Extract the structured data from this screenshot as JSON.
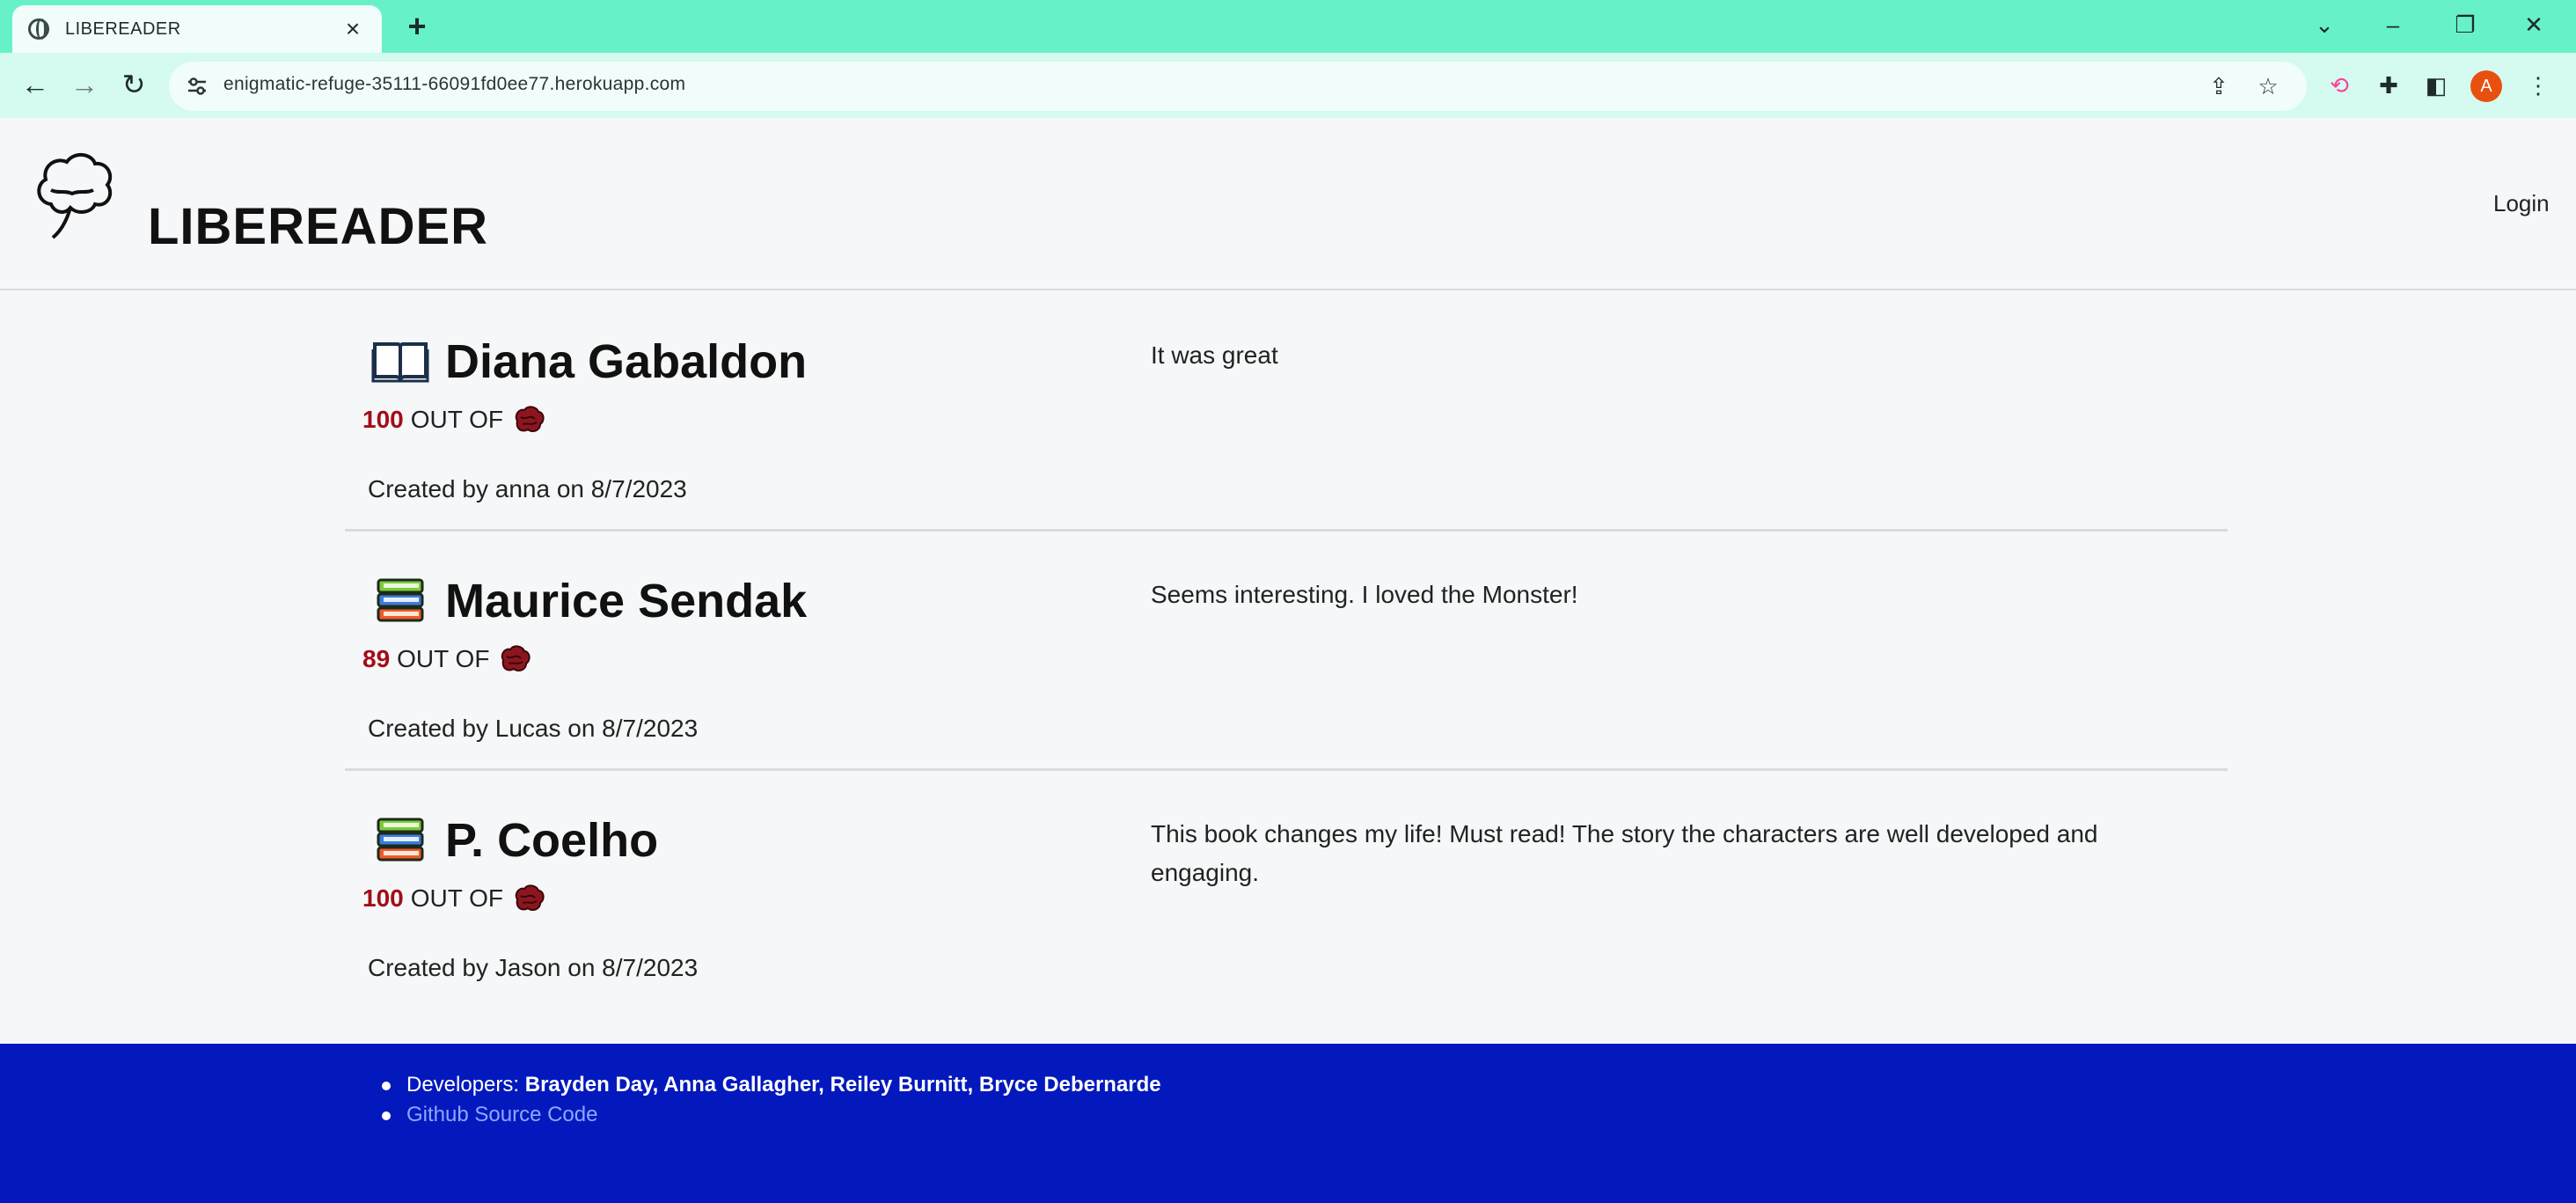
{
  "browser": {
    "tab_title": "LIBEREADER",
    "tab_close": "×",
    "new_tab": "+",
    "url": "enigmatic-refuge-35111-66091fd0ee77.herokuapp.com",
    "profile_initial": "A",
    "icons": [
      "globe-icon",
      "close-icon",
      "plus-icon",
      "back-icon",
      "forward-icon",
      "reload-icon",
      "site-settings-icon",
      "share-icon",
      "star-icon",
      "extension-icon",
      "puzzle-icon",
      "sidepanel-icon",
      "more-icon"
    ],
    "window_controls": [
      "chevron-down",
      "minimize",
      "restore",
      "close"
    ]
  },
  "header": {
    "brand": "LIBEREADER",
    "login": "Login"
  },
  "reviews": [
    {
      "author": "Diana Gabaldon",
      "icon": "open-book-icon",
      "score": "100",
      "out_of": "OUT OF",
      "created": "Created by anna on 8/7/2023",
      "comment": "It was great"
    },
    {
      "author": "Maurice Sendak",
      "icon": "books-stack-icon",
      "score": "89",
      "out_of": "OUT OF",
      "created": "Created by Lucas on 8/7/2023",
      "comment": "Seems interesting. I loved the Monster!"
    },
    {
      "author": "P. Coelho",
      "icon": "books-stack-icon",
      "score": "100",
      "out_of": "OUT OF",
      "created": "Created by Jason on 8/7/2023",
      "comment": "This book changes my life! Must read! The story the characters are well developed and engaging."
    }
  ],
  "footer": {
    "developers_label": "Developers: ",
    "developers": "Brayden Day, Anna Gallagher, Reiley Burnitt, Bryce Debernarde",
    "github": "Github Source Code"
  },
  "colors": {
    "tabbar": "#67f1c9",
    "toolbar": "#d5faef",
    "score": "#a30d18",
    "footer": "#0419bd",
    "footer_link": "#8ea6ff",
    "profile": "#e8500f"
  }
}
